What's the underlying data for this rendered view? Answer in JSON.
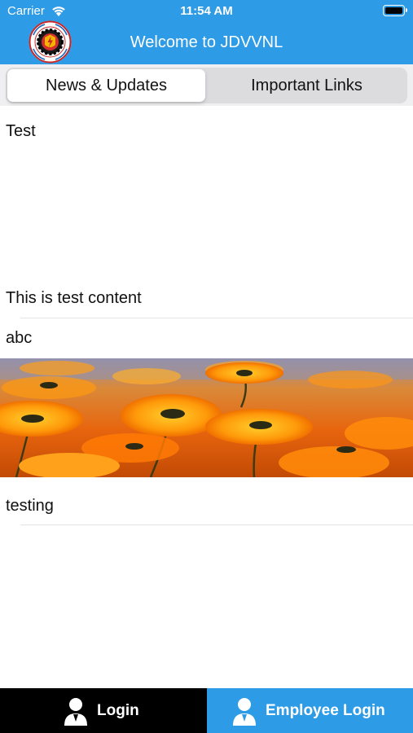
{
  "status_bar": {
    "carrier": "Carrier",
    "time": "11:54 AM",
    "wifi_icon": "wifi-icon",
    "battery_icon": "battery-icon"
  },
  "nav": {
    "title": "Welcome to JDVVNL",
    "logo_icon": "jdvvnl-logo"
  },
  "tabs": [
    {
      "label": "News & Updates",
      "selected": true
    },
    {
      "label": "Important Links",
      "selected": false
    }
  ],
  "news": [
    {
      "title": "Test",
      "content": "This is test content"
    },
    {
      "title": "abc",
      "image": "orange-flowers-photo"
    },
    {
      "title": "testing"
    }
  ],
  "bottom_bar": {
    "login_label": "Login",
    "employee_login_label": "Employee Login",
    "icon": "user-icon"
  },
  "colors": {
    "primary": "#2e9be6",
    "login_tab": "#000000",
    "text": "#111111"
  }
}
